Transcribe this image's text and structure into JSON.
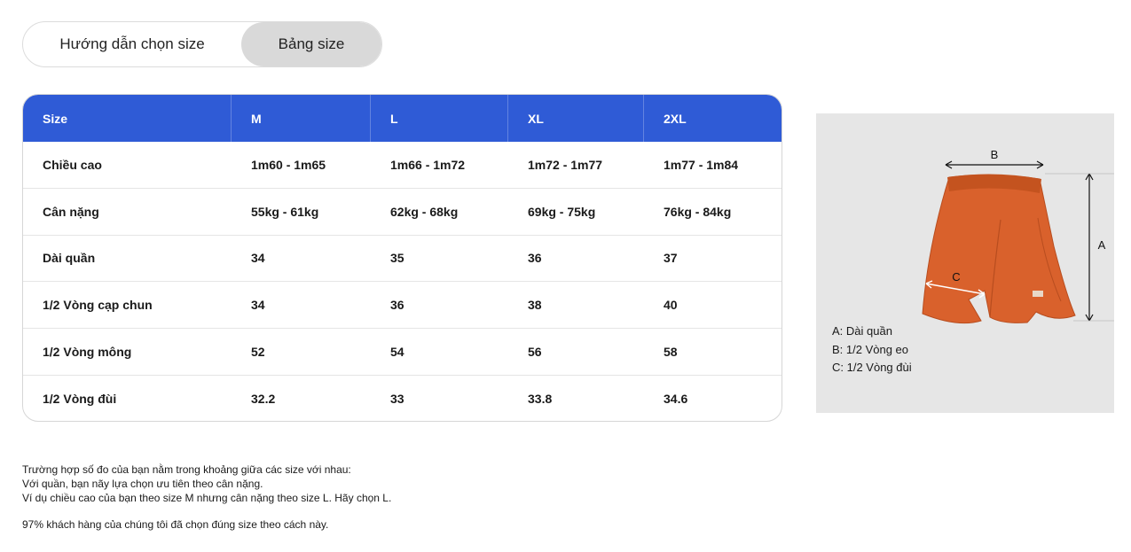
{
  "tabs": [
    {
      "label": "Hướng dẫn chọn size",
      "active": false
    },
    {
      "label": "Bảng size",
      "active": true
    }
  ],
  "table": {
    "headers": [
      "Size",
      "M",
      "L",
      "XL",
      "2XL"
    ],
    "rows": [
      [
        "Chiều cao",
        "1m60 - 1m65",
        "1m66 - 1m72",
        "1m72 - 1m77",
        "1m77 - 1m84"
      ],
      [
        "Cân nặng",
        "55kg - 61kg",
        "62kg - 68kg",
        "69kg - 75kg",
        "76kg - 84kg"
      ],
      [
        "Dài quần",
        "34",
        "35",
        "36",
        "37"
      ],
      [
        "1/2 Vòng cạp chun",
        "34",
        "36",
        "38",
        "40"
      ],
      [
        "1/2 Vòng mông",
        "52",
        "54",
        "56",
        "58"
      ],
      [
        "1/2 Vòng đùi",
        "32.2",
        "33",
        "33.8",
        "34.6"
      ]
    ]
  },
  "diagram": {
    "labels": {
      "a": "A",
      "b": "B",
      "c": "C"
    },
    "legend": [
      "A: Dài quần",
      "B: 1/2 Vòng eo",
      "C: 1/2 Vòng đùi"
    ],
    "shorts_color": "#d9612c"
  },
  "notes": [
    "Trường hợp số đo của bạn nằm trong khoảng giữa các size với nhau:",
    "Với quần, bạn nãy lựa chọn ưu tiên theo cân nặng.",
    "Ví dụ chiều cao của bạn theo size M nhưng cân nặng theo size L. Hãy chọn L.",
    "97% khách hàng của chúng tôi đã chọn đúng size theo cách này."
  ],
  "colors": {
    "header_bg": "#2f5bd6",
    "active_tab_bg": "#d9d9d9"
  }
}
